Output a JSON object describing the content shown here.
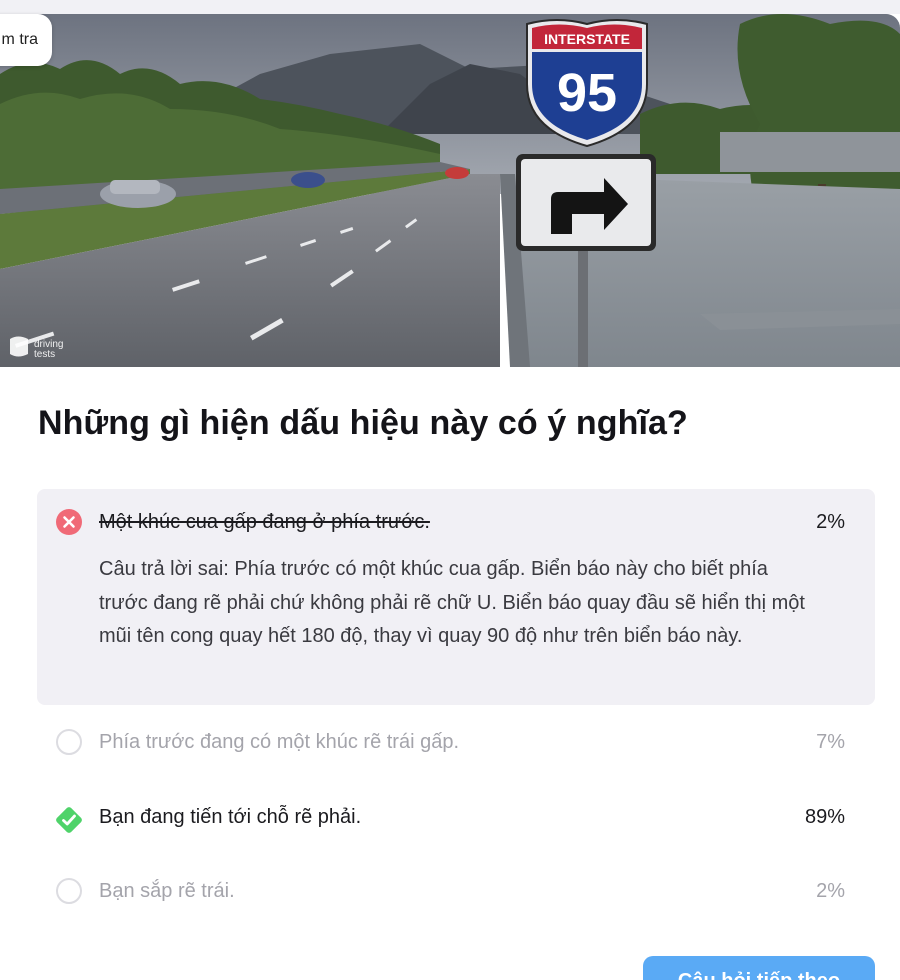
{
  "header": {
    "chip_label": "m tra"
  },
  "hero": {
    "watermark_line1": "driving",
    "watermark_line2": "tests",
    "sign_top_text": "INTERSTATE",
    "sign_number": "95"
  },
  "question": "Những gì hiện dấu hiệu này có ý nghĩa?",
  "answers": [
    {
      "label": "Một khúc cua gấp đang ở phía trước.",
      "percent": "2%",
      "state": "wrong",
      "explanation": "Câu trả lời sai: Phía trước có một khúc cua gấp. Biển báo này cho biết phía trước đang rẽ phải chứ không phải rẽ chữ U. Biển báo quay đầu sẽ hiển thị một mũi tên cong quay hết 180 độ, thay vì quay 90 độ như trên biển báo này."
    },
    {
      "label": "Phía trước đang có một khúc rẽ trái gấp.",
      "percent": "7%",
      "state": "unselected"
    },
    {
      "label": "Bạn đang tiến tới chỗ rẽ phải.",
      "percent": "89%",
      "state": "correct"
    },
    {
      "label": "Bạn sắp rẽ trái.",
      "percent": "2%",
      "state": "unselected"
    }
  ],
  "next_button": {
    "label": "Câu hỏi tiếp theo"
  },
  "colors": {
    "wrong": "#f06a77",
    "correct": "#4fd36a",
    "accent": "#5aaaf5",
    "panel": "#f1f0f5",
    "muted_text": "#a4a4ab"
  },
  "icons": {
    "wrong": "x-circle-icon",
    "correct": "check-diamond-icon",
    "unselected": "radio-circle-icon"
  }
}
